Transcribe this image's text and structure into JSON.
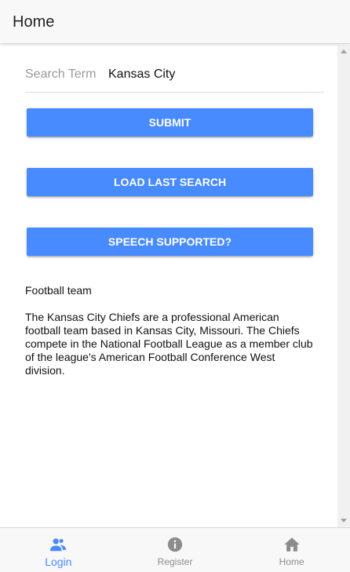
{
  "header": {
    "title": "Home"
  },
  "search": {
    "label": "Search Term",
    "value": "Kansas City"
  },
  "buttons": {
    "submit": "SUBMIT",
    "load_last_search": "LOAD LAST SEARCH",
    "speech_supported": "SPEECH SUPPORTED?"
  },
  "result": {
    "type": "Football team",
    "description": "The Kansas City Chiefs are a professional American football team based in Kansas City, Missouri. The Chiefs compete in the National Football League as a member club of the league's American Football Conference West division."
  },
  "tabs": [
    {
      "label": "Login",
      "icon": "people-icon",
      "active": true
    },
    {
      "label": "Register",
      "icon": "info-icon",
      "active": false
    },
    {
      "label": "Home",
      "icon": "home-icon",
      "active": false
    }
  ],
  "colors": {
    "accent": "#488aff",
    "tab_inactive": "#8c8c8c",
    "header_bg": "#f8f8f8"
  }
}
